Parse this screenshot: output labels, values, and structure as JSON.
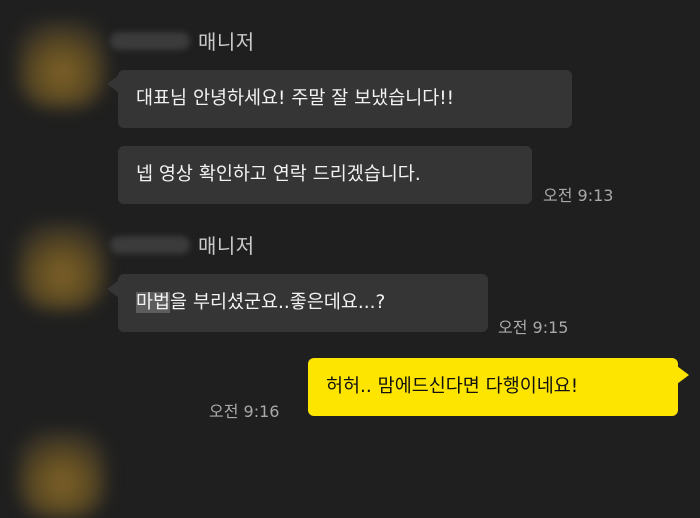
{
  "theme": {
    "background": "#1f1f1f",
    "bubble_other": "#353535",
    "bubble_mine": "#fee500"
  },
  "messages": {
    "group1": {
      "sender_suffix": "매니저",
      "msg1": "대표님 안녕하세요! 주말 잘 보냈습니다!!",
      "msg2": "넵 영상 확인하고 연락 드리겠습니다.",
      "time": "오전 9:13"
    },
    "group2": {
      "sender_suffix": "매니저",
      "msg_sel": "마법",
      "msg_rest": "을 부리셨군요..좋은데요...?",
      "time": "오전 9:15"
    },
    "mine": {
      "msg": "허허.. 맘에드신다면 다행이네요!",
      "time": "오전 9:16"
    }
  }
}
